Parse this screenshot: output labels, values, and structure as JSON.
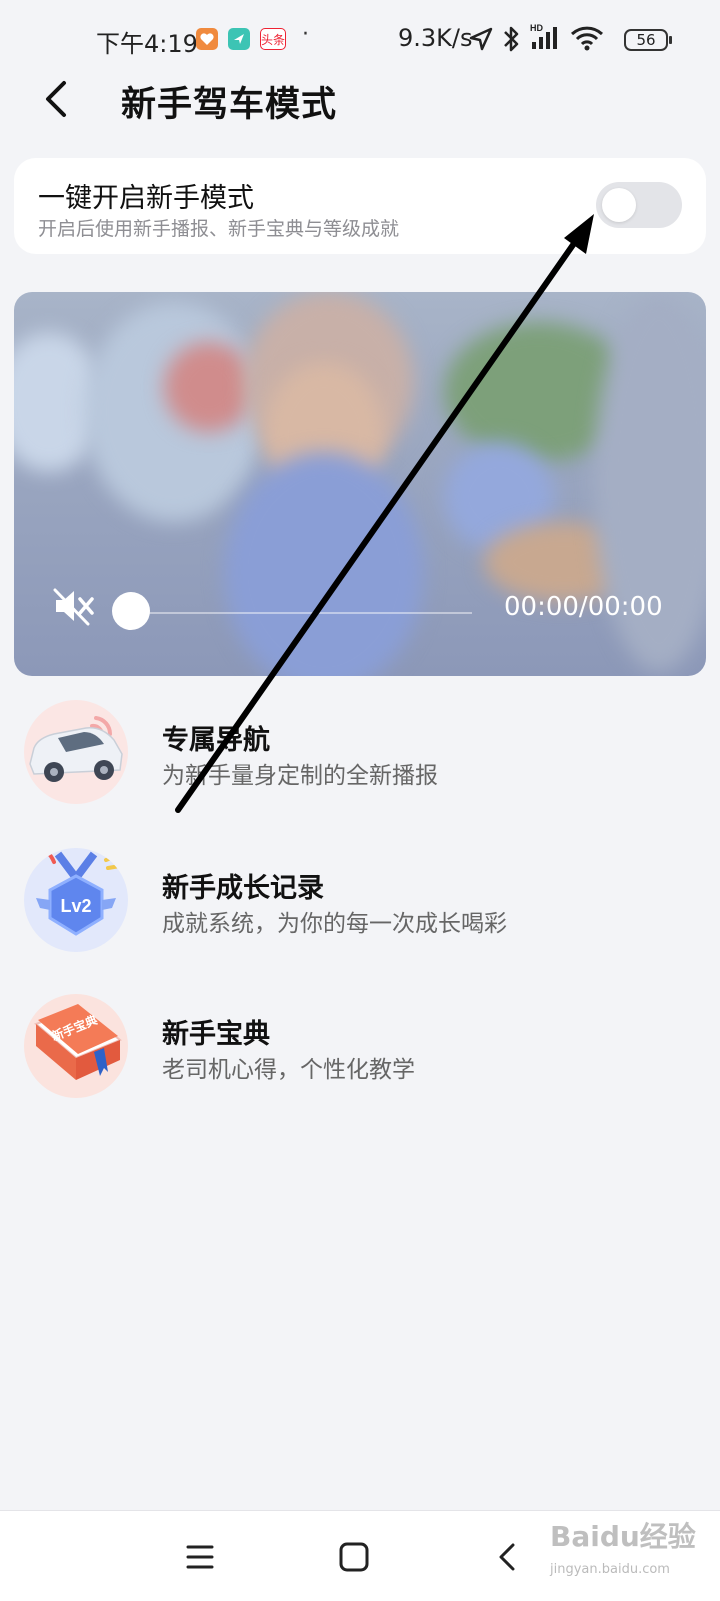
{
  "status_bar": {
    "time": "下午4:19",
    "net_speed": "9.3K/s",
    "battery": "56",
    "network_badge": "HD",
    "app_badge": "头条",
    "icons": [
      "health-app-icon",
      "maps-app-icon",
      "toutiao-app-icon",
      "location-icon",
      "bluetooth-icon",
      "signal-icon",
      "wifi-icon",
      "battery-icon"
    ]
  },
  "header": {
    "back_icon": "chevron-left-icon",
    "title": "新手驾车模式"
  },
  "toggle_card": {
    "title": "一键开启新手模式",
    "subtitle": "开启后使用新手播报、新手宝典与等级成就",
    "switch_on": false
  },
  "video": {
    "time": "00:00/00:00",
    "muted": true,
    "progress": 0
  },
  "features": [
    {
      "icon": "car-icon",
      "title": "专属导航",
      "subtitle": "为新手量身定制的全新播报"
    },
    {
      "icon": "lv2-medal-icon",
      "title": "新手成长记录",
      "subtitle": "成就系统，为你的每一次成长喝彩",
      "badge": "Lv2"
    },
    {
      "icon": "book-icon",
      "title": "新手宝典",
      "subtitle": "老司机心得，个性化教学",
      "badge": "新手宝典"
    }
  ],
  "nav_bar": {
    "icons": [
      "menu-icon",
      "home-icon",
      "back-icon"
    ]
  },
  "watermark": {
    "text": "Baidu经验",
    "url": "jingyan.baidu.com"
  },
  "colors": {
    "background": "#f3f4f7",
    "card": "#ffffff",
    "switch_off": "#e3e4e8",
    "arrow": "#000000"
  }
}
